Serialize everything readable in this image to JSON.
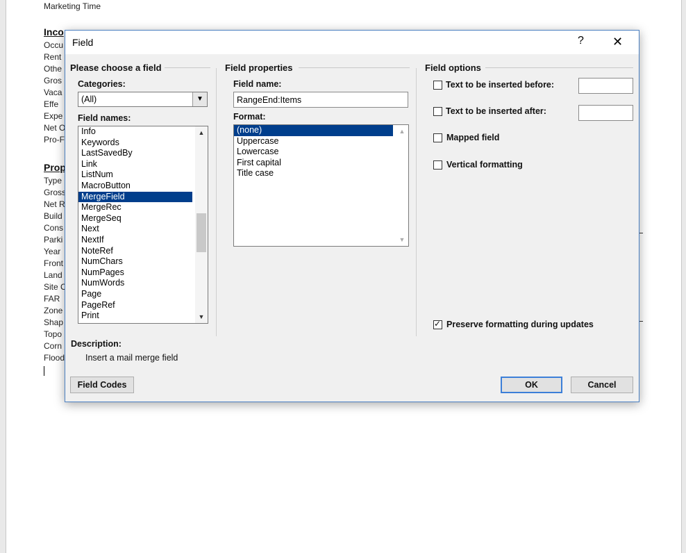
{
  "document": {
    "header_line": "Marketing Time",
    "section1_heading": "Inco",
    "section1_lines": [
      "Occu",
      "Rent",
      "Othe",
      "Gros",
      "Vaca",
      "Effe",
      "Expe",
      "Net O",
      "Pro-F"
    ],
    "section2_heading": "Prop",
    "section2_lines": [
      "Type",
      "Gross",
      "Net R",
      "Build",
      "Cons",
      "Parki",
      "Year",
      "Front",
      "Land",
      "Site C",
      "FAR",
      "Zone",
      "Shap",
      "Topo",
      "Corn",
      "Flood"
    ]
  },
  "dialog": {
    "title": "Field",
    "help_glyph": "?",
    "close_glyph": "✕",
    "choose_section": "Please choose a field",
    "categories_label": "Categories:",
    "categories_value": "(All)",
    "field_names_label": "Field names:",
    "field_names": [
      "Info",
      "Keywords",
      "LastSavedBy",
      "Link",
      "ListNum",
      "MacroButton",
      "MergeField",
      "MergeRec",
      "MergeSeq",
      "Next",
      "NextIf",
      "NoteRef",
      "NumChars",
      "NumPages",
      "NumWords",
      "Page",
      "PageRef",
      "Print"
    ],
    "selected_field": "MergeField",
    "properties_section": "Field properties",
    "field_name_label": "Field name:",
    "field_name_value": "RangeEnd:Items",
    "format_label": "Format:",
    "formats": [
      "(none)",
      "Uppercase",
      "Lowercase",
      "First capital",
      "Title case"
    ],
    "selected_format": "(none)",
    "options_section": "Field options",
    "opt_before": "Text to be inserted before:",
    "opt_after": "Text to be inserted after:",
    "opt_mapped": "Mapped field",
    "opt_vertical": "Vertical formatting",
    "opt_preserve": "Preserve formatting during updates",
    "preserve_checked": true,
    "description_label": "Description:",
    "description_text": "Insert a mail merge field",
    "field_codes_button": "Field Codes",
    "ok_button": "OK",
    "cancel_button": "Cancel",
    "accent_color": "#003e8c"
  }
}
